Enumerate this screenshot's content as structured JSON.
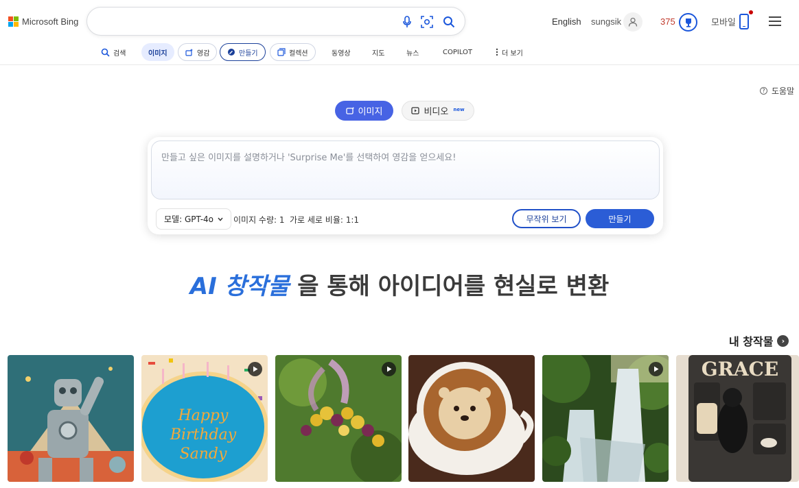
{
  "header": {
    "logo_text": "Microsoft Bing",
    "search_placeholder": "",
    "language": "English",
    "username": "sungsik",
    "points": "375",
    "mobile_label": "모바일"
  },
  "nav": {
    "items": [
      {
        "label": "검색",
        "icon": "search-icon"
      },
      {
        "label": "이미지",
        "active": true
      },
      {
        "label": "영감",
        "icon": "inspiration-icon"
      },
      {
        "label": "만들기",
        "icon": "create-icon"
      },
      {
        "label": "컬렉션",
        "icon": "collection-icon"
      },
      {
        "label": "동영상"
      },
      {
        "label": "지도"
      },
      {
        "label": "뉴스"
      },
      {
        "label": "COPILOT"
      },
      {
        "label": "더 보기",
        "icon": "more-vertical-icon"
      }
    ]
  },
  "help_label": "도움말",
  "mode_tabs": {
    "image_label": "이미지",
    "video_label": "비디오",
    "video_badge": "new"
  },
  "prompt": {
    "placeholder": "만들고 싶은 이미지를 설명하거나 'Surprise Me'를 선택하여 영감을 얻으세요!",
    "model_label": "모델: GPT-4o",
    "image_count": "이미지 수량: 1",
    "aspect_ratio": "가로 세로 비율: 1:1",
    "surprise_label": "무작위 보기",
    "create_label": "만들기"
  },
  "headline": {
    "highlight": "AI 창작물",
    "rest": "을 통해 아이디어를 현실로 변환"
  },
  "my_creations_label": "내 창작물",
  "gallery": [
    {
      "name": "retro-robot-image",
      "video": false
    },
    {
      "name": "birthday-cake-image",
      "video": true,
      "cake_text": "Happy Birthday Sandy"
    },
    {
      "name": "flower-hummingbird-image",
      "video": true
    },
    {
      "name": "otter-latte-image",
      "video": false
    },
    {
      "name": "waterfall-image",
      "video": true
    },
    {
      "name": "grace-dog-image",
      "video": false,
      "sign_text": "GRACE"
    }
  ]
}
